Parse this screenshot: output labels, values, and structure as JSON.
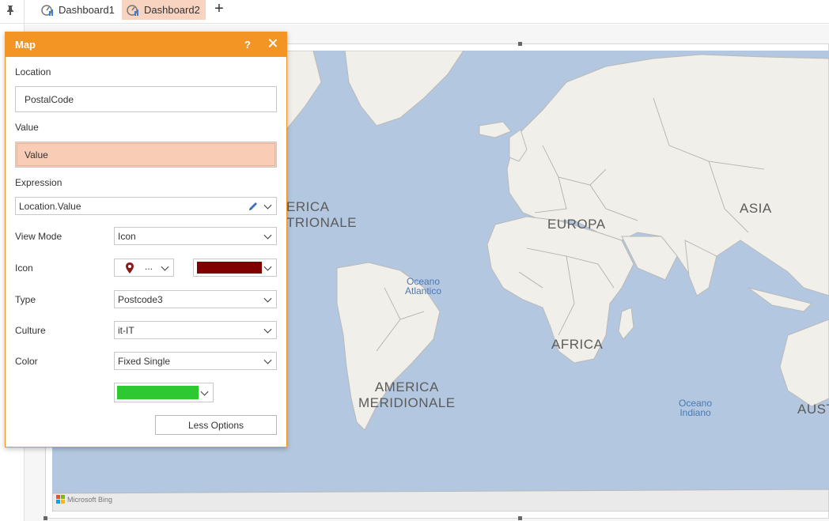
{
  "tabs": [
    {
      "label": "Dashboard1",
      "active": false
    },
    {
      "label": "Dashboard2",
      "active": true
    }
  ],
  "add_tab_icon": "plus-icon",
  "panel": {
    "title": "Map",
    "help_label": "?",
    "location_label": "Location",
    "location_value": "PostalCode",
    "value_label": "Value",
    "value_value": "Value",
    "expression_label": "Expression",
    "expression_value": "Location.Value",
    "view_mode_label": "View Mode",
    "view_mode_value": "Icon",
    "icon_label": "Icon",
    "icon_picker_text": "...",
    "icon_color": "#800000",
    "type_label": "Type",
    "type_value": "Postcode3",
    "culture_label": "Culture",
    "culture_value": "it-IT",
    "color_label": "Color",
    "color_value": "Fixed Single",
    "fixed_color": "#2ec832",
    "less_options_label": "Less Options",
    "accent_color": "#f39524"
  },
  "map": {
    "labels": {
      "north_america": "ERICA\nTRIONALE",
      "europe": "EUROPA",
      "asia": "ASIA",
      "africa": "AFRICA",
      "south_america": "AMERICA\nMERIDIONALE",
      "australia": "AUST"
    },
    "oceans": {
      "atlantic": "Oceano\nAtlantico",
      "indian": "Oceano\nIndiano"
    },
    "attribution": "Microsoft Bing",
    "water_color": "#b3c8e0",
    "land_color": "#f1efe9"
  }
}
